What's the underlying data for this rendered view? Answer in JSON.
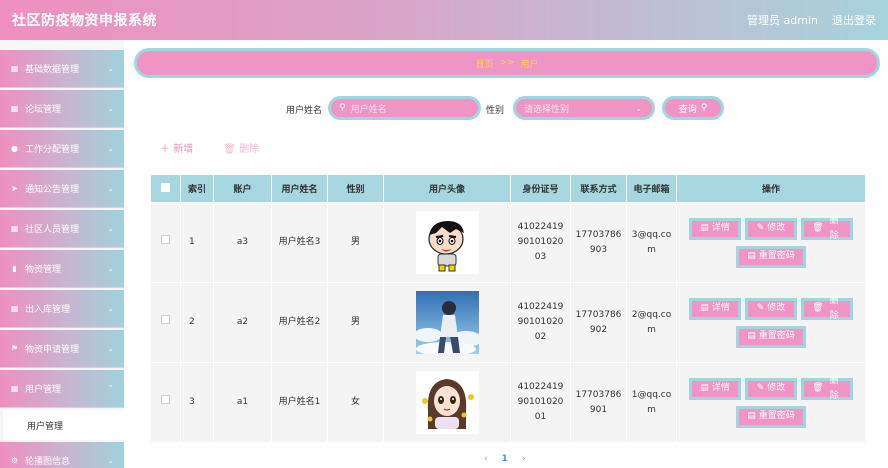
{
  "header": {
    "app_title": "社区防疫物资申报系统",
    "user_label": "管理员 admin",
    "logout": "退出登录"
  },
  "sidebar": {
    "items": [
      {
        "label": "基础数据管理",
        "icon": "grid-icon"
      },
      {
        "label": "论坛管理",
        "icon": "grid-icon"
      },
      {
        "label": "工作分配管理",
        "icon": "user-icon"
      },
      {
        "label": "通知公告管理",
        "icon": "send-icon"
      },
      {
        "label": "社区人员管理",
        "icon": "grid-icon"
      },
      {
        "label": "物资管理",
        "icon": "bar-chart-icon"
      },
      {
        "label": "出入库管理",
        "icon": "grid-icon"
      },
      {
        "label": "物资申请管理",
        "icon": "flag-icon"
      },
      {
        "label": "用户管理",
        "icon": "grid-icon"
      },
      {
        "label": "轮播图信息",
        "icon": "gear-icon"
      }
    ],
    "submenu": {
      "label": "用户管理"
    }
  },
  "breadcrumb": {
    "home": "首页",
    "sep": ">>",
    "current": "用户"
  },
  "search": {
    "name_label": "用户姓名",
    "name_placeholder": "用户姓名",
    "gender_label": "性别",
    "gender_placeholder": "请选择性别",
    "query_label": "查询"
  },
  "actions": {
    "add": "新增",
    "delete": "删除"
  },
  "table": {
    "headers": [
      "",
      "索引",
      "账户",
      "用户姓名",
      "性别",
      "用户头像",
      "身份证号",
      "联系方式",
      "电子邮箱",
      "操作"
    ],
    "rows": [
      {
        "index": "1",
        "account": "a3",
        "name": "用户姓名3",
        "gender": "男",
        "id_card": [
          "41022419",
          "90101020",
          "03"
        ],
        "phone": [
          "17703786",
          "903"
        ],
        "email": [
          "3@qq.co",
          "m"
        ],
        "avatar": "cartoon-boy-avatar"
      },
      {
        "index": "2",
        "account": "a2",
        "name": "用户姓名2",
        "gender": "男",
        "id_card": [
          "41022419",
          "90101020",
          "02"
        ],
        "phone": [
          "17703786",
          "902"
        ],
        "email": [
          "2@qq.co",
          "m"
        ],
        "avatar": "anime-sky-avatar"
      },
      {
        "index": "3",
        "account": "a1",
        "name": "用户姓名1",
        "gender": "女",
        "id_card": [
          "41022419",
          "90101020",
          "01"
        ],
        "phone": [
          "17703786",
          "901"
        ],
        "email": [
          "1@qq.co",
          "m"
        ],
        "avatar": "cartoon-girl-avatar"
      }
    ],
    "ops": {
      "detail": "详情",
      "edit": "修改",
      "delete": "删除",
      "reset": "重置密码"
    }
  },
  "pager": {
    "prev": "‹",
    "current": "1",
    "next": "›"
  },
  "colors": {
    "pink": "#ef94c4",
    "teal": "#9fd6e0",
    "breadcrumb_text": "#f7d54a"
  }
}
